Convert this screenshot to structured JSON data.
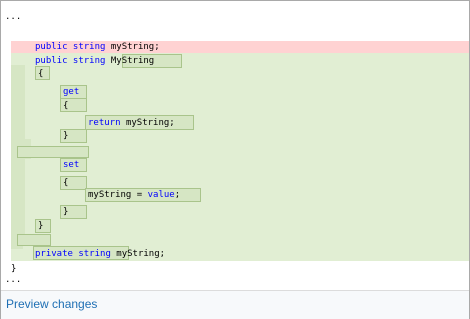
{
  "diff": {
    "ellipsis_top": "...",
    "ellipsis_bottom": "...",
    "lines": [
      {
        "kw": "public string ",
        "rest": "myString;"
      },
      {
        "kw": "public string ",
        "rest": "MyString"
      },
      {
        "kw": "",
        "rest": "{"
      },
      {
        "kw": "get",
        "rest": ""
      },
      {
        "kw": "",
        "rest": "{"
      },
      {
        "kw": "return ",
        "rest": "myString;"
      },
      {
        "kw": "",
        "rest": "}"
      },
      {
        "kw": "set",
        "rest": ""
      },
      {
        "kw": "",
        "rest": "{"
      },
      {
        "pre": "myString = ",
        "kw": "value",
        "rest": ";"
      },
      {
        "kw": "",
        "rest": "}"
      },
      {
        "kw": "",
        "rest": "}"
      },
      {
        "kw": "private string ",
        "rest": "myString;"
      },
      {
        "kw": "",
        "rest": "}"
      }
    ]
  },
  "footer": {
    "preview_label": "Preview changes"
  },
  "colors": {
    "removed_line": "#ffd2d2",
    "added_line": "#e1eed3",
    "keyword": "#0000ff",
    "link": "#1e6fb4"
  }
}
